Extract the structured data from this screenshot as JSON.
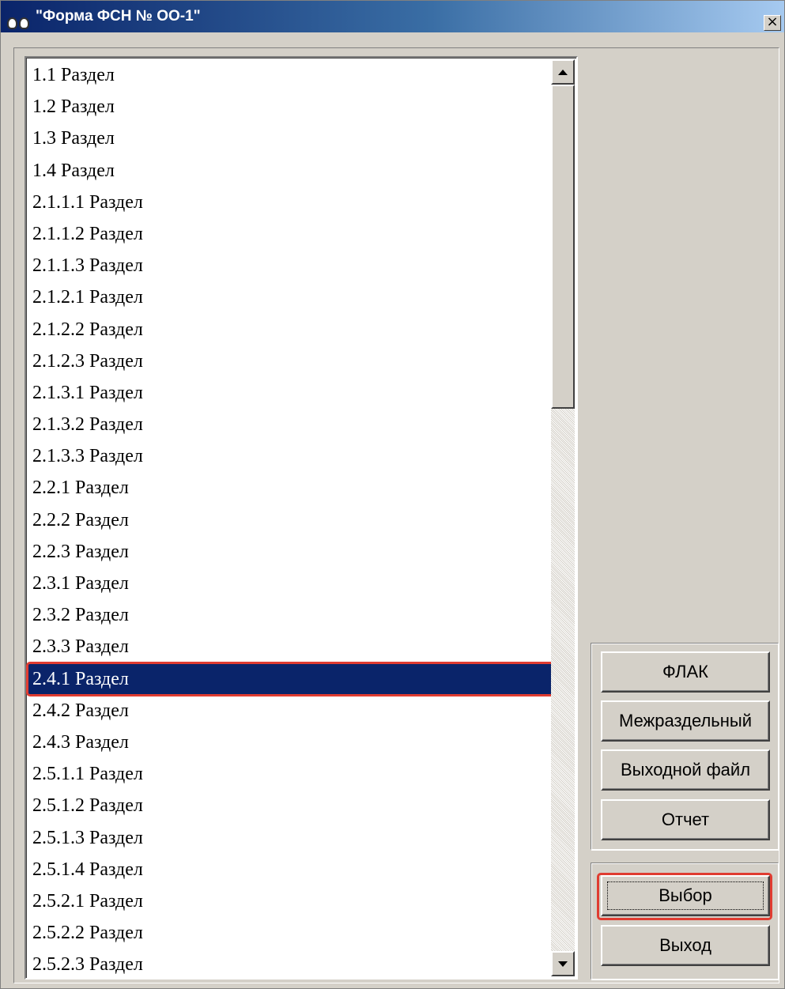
{
  "window": {
    "title": "\"Форма ФСН № ОО-1\"",
    "close_label": "×"
  },
  "list": {
    "items": [
      "1.1 Раздел",
      "1.2 Раздел",
      "1.3 Раздел",
      "1.4 Раздел",
      "2.1.1.1 Раздел",
      "2.1.1.2 Раздел",
      "2.1.1.3 Раздел",
      "2.1.2.1 Раздел",
      "2.1.2.2 Раздел",
      "2.1.2.3 Раздел",
      "2.1.3.1 Раздел",
      "2.1.3.2 Раздел",
      "2.1.3.3 Раздел",
      "2.2.1 Раздел",
      "2.2.2 Раздел",
      "2.2.3 Раздел",
      "2.3.1 Раздел",
      "2.3.2 Раздел",
      "2.3.3 Раздел",
      "2.4.1 Раздел",
      "2.4.2 Раздел",
      "2.4.3 Раздел",
      "2.5.1.1 Раздел",
      "2.5.1.2 Раздел",
      "2.5.1.3 Раздел",
      "2.5.1.4 Раздел",
      "2.5.2.1 Раздел",
      "2.5.2.2 Раздел",
      "2.5.2.3 Раздел"
    ],
    "selected_index": 19
  },
  "buttons": {
    "flak": "ФЛАК",
    "mezhrazdelny": "Межраздельный",
    "vyhodnoy_fail": "Выходной файл",
    "otchet": "Отчет",
    "vybor": "Выбор",
    "vyhod": "Выход"
  },
  "colors": {
    "selection_bg": "#0a246a",
    "highlight": "#e03c31",
    "face": "#d4d0c8"
  }
}
